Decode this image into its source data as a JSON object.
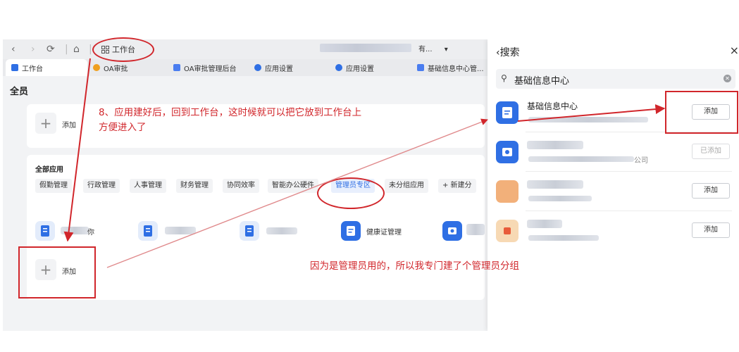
{
  "browser": {
    "workbench_label": "工作台",
    "address_tail": "有...",
    "dropdown_caret": "▾"
  },
  "tabs": [
    {
      "label": "工作台",
      "color": "#2f6fe4"
    },
    {
      "label": "OA审批",
      "color": "#f0a020"
    },
    {
      "label": "OA审批管理后台",
      "color": "#4a7df0"
    },
    {
      "label": "应用设置",
      "color": "#2f6fe4"
    },
    {
      "label": "应用设置",
      "color": "#2f6fe4"
    },
    {
      "label": "基础信息中心管...",
      "color": "#4a7df0"
    }
  ],
  "page": {
    "staff_label": "全员",
    "top_add_label": "添加",
    "section_title": "全部应用",
    "categories": [
      "假勤管理",
      "行政管理",
      "人事管理",
      "财务管理",
      "协同效率",
      "智能办公硬件",
      "管理员专区",
      "未分组应用",
      "+ 新建分"
    ],
    "selected_category": "管理员专区",
    "apps": [
      {
        "name": "",
        "partial": "你"
      },
      {
        "name": ""
      },
      {
        "name": ""
      },
      {
        "name": "健康证管理"
      },
      {
        "name": ""
      }
    ],
    "bottom_add_label": "添加"
  },
  "panel": {
    "back_label": "搜索",
    "close_icon": "×",
    "search_value": "基础信息中心",
    "results": [
      {
        "name": "基础信息中心",
        "button": "添加",
        "enabled": true
      },
      {
        "name": "",
        "subtitle_tail": "公司",
        "button": "已添加",
        "enabled": false
      },
      {
        "name": "",
        "button": "添加",
        "enabled": true
      },
      {
        "name": "",
        "button": "添加",
        "enabled": true
      }
    ]
  },
  "annotations": {
    "step8": "8、应用建好后，回到工作台，这时候就可以把它放到工作台上方便进入了",
    "step8_line1": "8、应用建好后，回到工作台，这时候就可以把它放到工作台上",
    "step8_line2": "方便进入了",
    "admin_group_note": "因为是管理员用的，所以我专门建了个管理员分组"
  },
  "colors": {
    "accent": "#2f6fe4",
    "annotation_red": "#d1262b",
    "page_bg": "#f2f3f5"
  }
}
